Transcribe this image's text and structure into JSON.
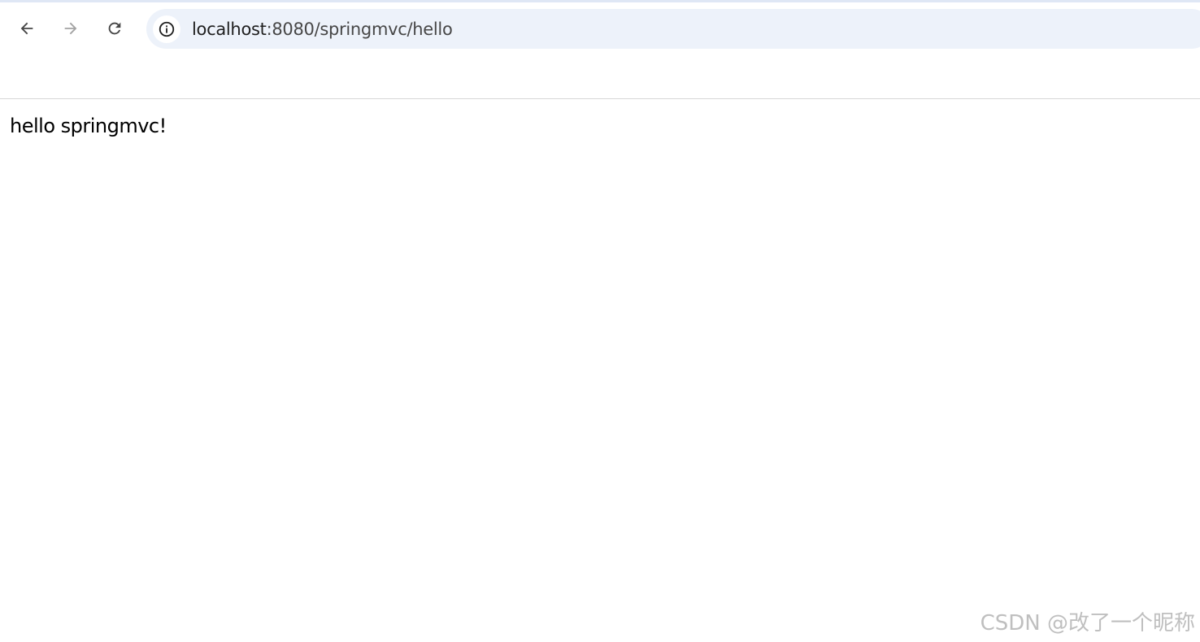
{
  "browser": {
    "url_host": "localhost",
    "url_rest": ":8080/springmvc/hello",
    "buttons": {
      "back": "arrow-left-icon",
      "forward": "arrow-right-icon",
      "reload": "reload-icon",
      "site_info": "info-circle-icon"
    },
    "forward_enabled": false
  },
  "page": {
    "text": "hello springmvc!"
  },
  "watermark": {
    "text": "CSDN @改了一个昵称"
  },
  "colors": {
    "omnibox_bg": "#edf2fa",
    "icon_active": "#474747",
    "icon_disabled": "#a3a3a3",
    "page_text": "#000000"
  }
}
